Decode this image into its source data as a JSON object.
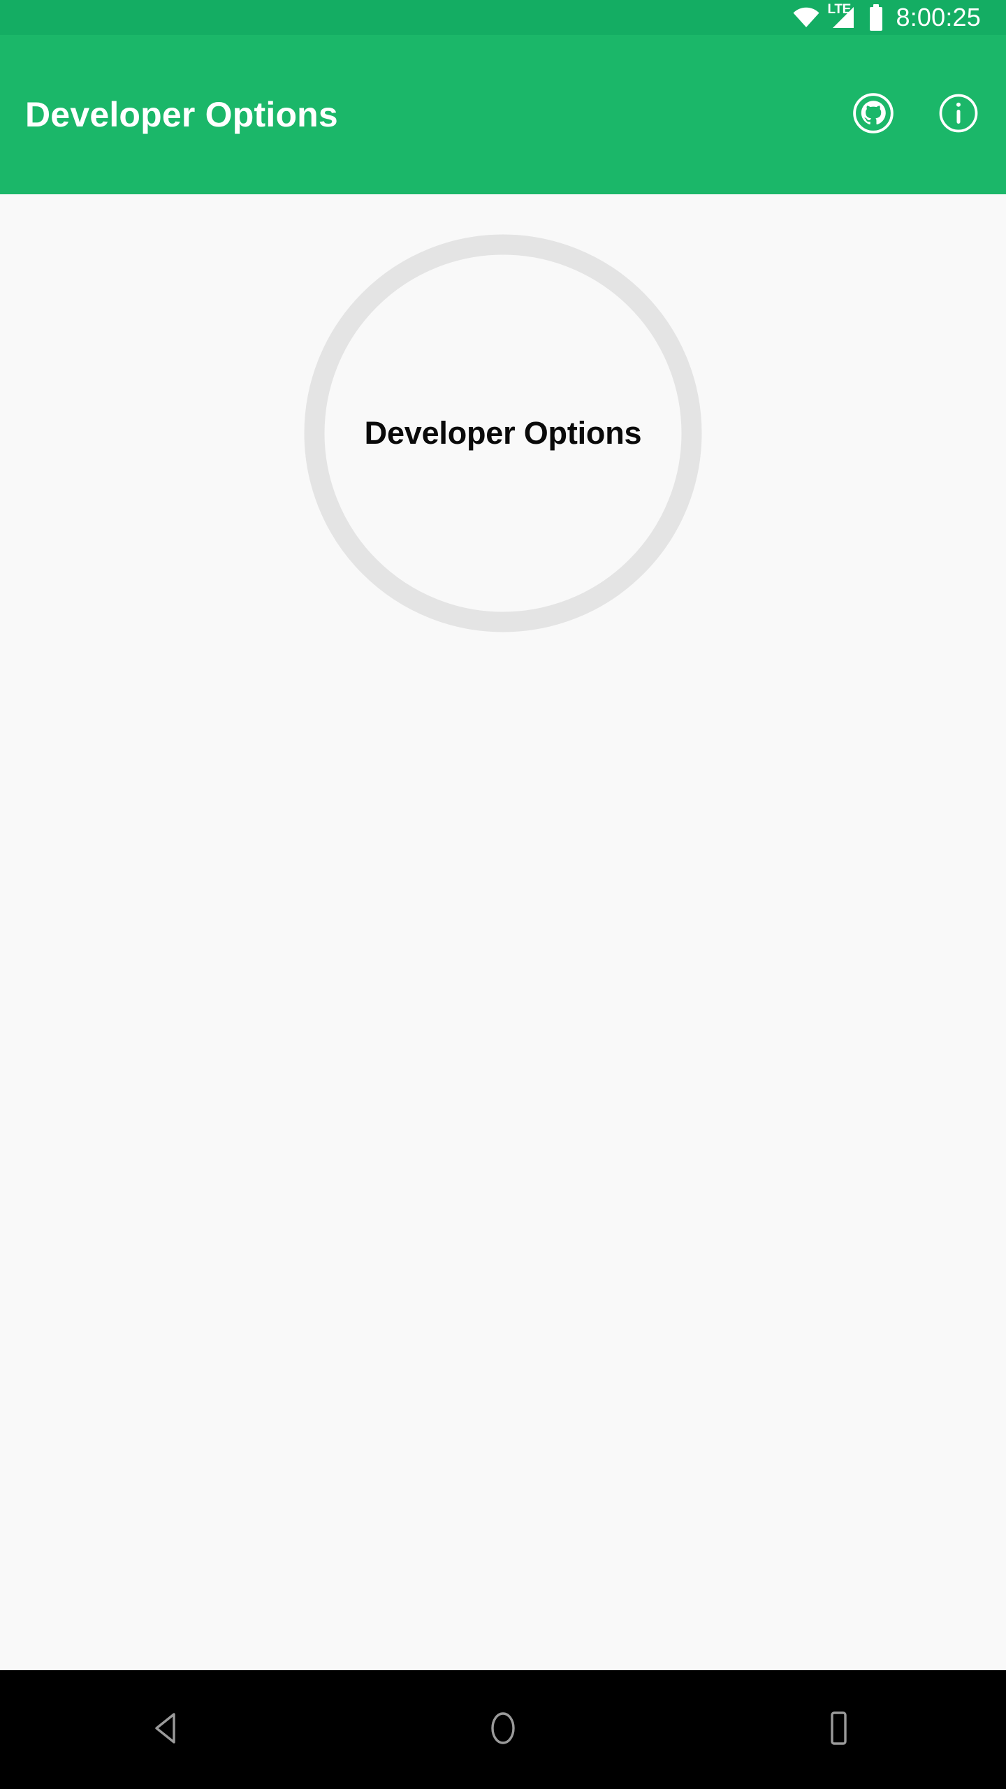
{
  "status_bar": {
    "background_color": "#14ad63",
    "network_label": "LTE",
    "time": "8:00:25",
    "icons": [
      "wifi-icon",
      "lte-signal-icon",
      "battery-icon"
    ]
  },
  "app_bar": {
    "background_color": "#1bb769",
    "title": "Developer Options",
    "actions": [
      {
        "name": "github-icon",
        "label": "GitHub"
      },
      {
        "name": "info-icon",
        "label": "Info"
      }
    ]
  },
  "content": {
    "background_color": "#f9f9f9",
    "progress_circle": {
      "label": "Developer Options",
      "ring_color": "#e4e4e4",
      "text_color": "#0a0a0a"
    }
  },
  "nav_bar": {
    "background_color": "#000000",
    "buttons": [
      {
        "name": "nav-back-button",
        "label": "Back"
      },
      {
        "name": "nav-home-button",
        "label": "Home"
      },
      {
        "name": "nav-recents-button",
        "label": "Recents"
      }
    ]
  }
}
